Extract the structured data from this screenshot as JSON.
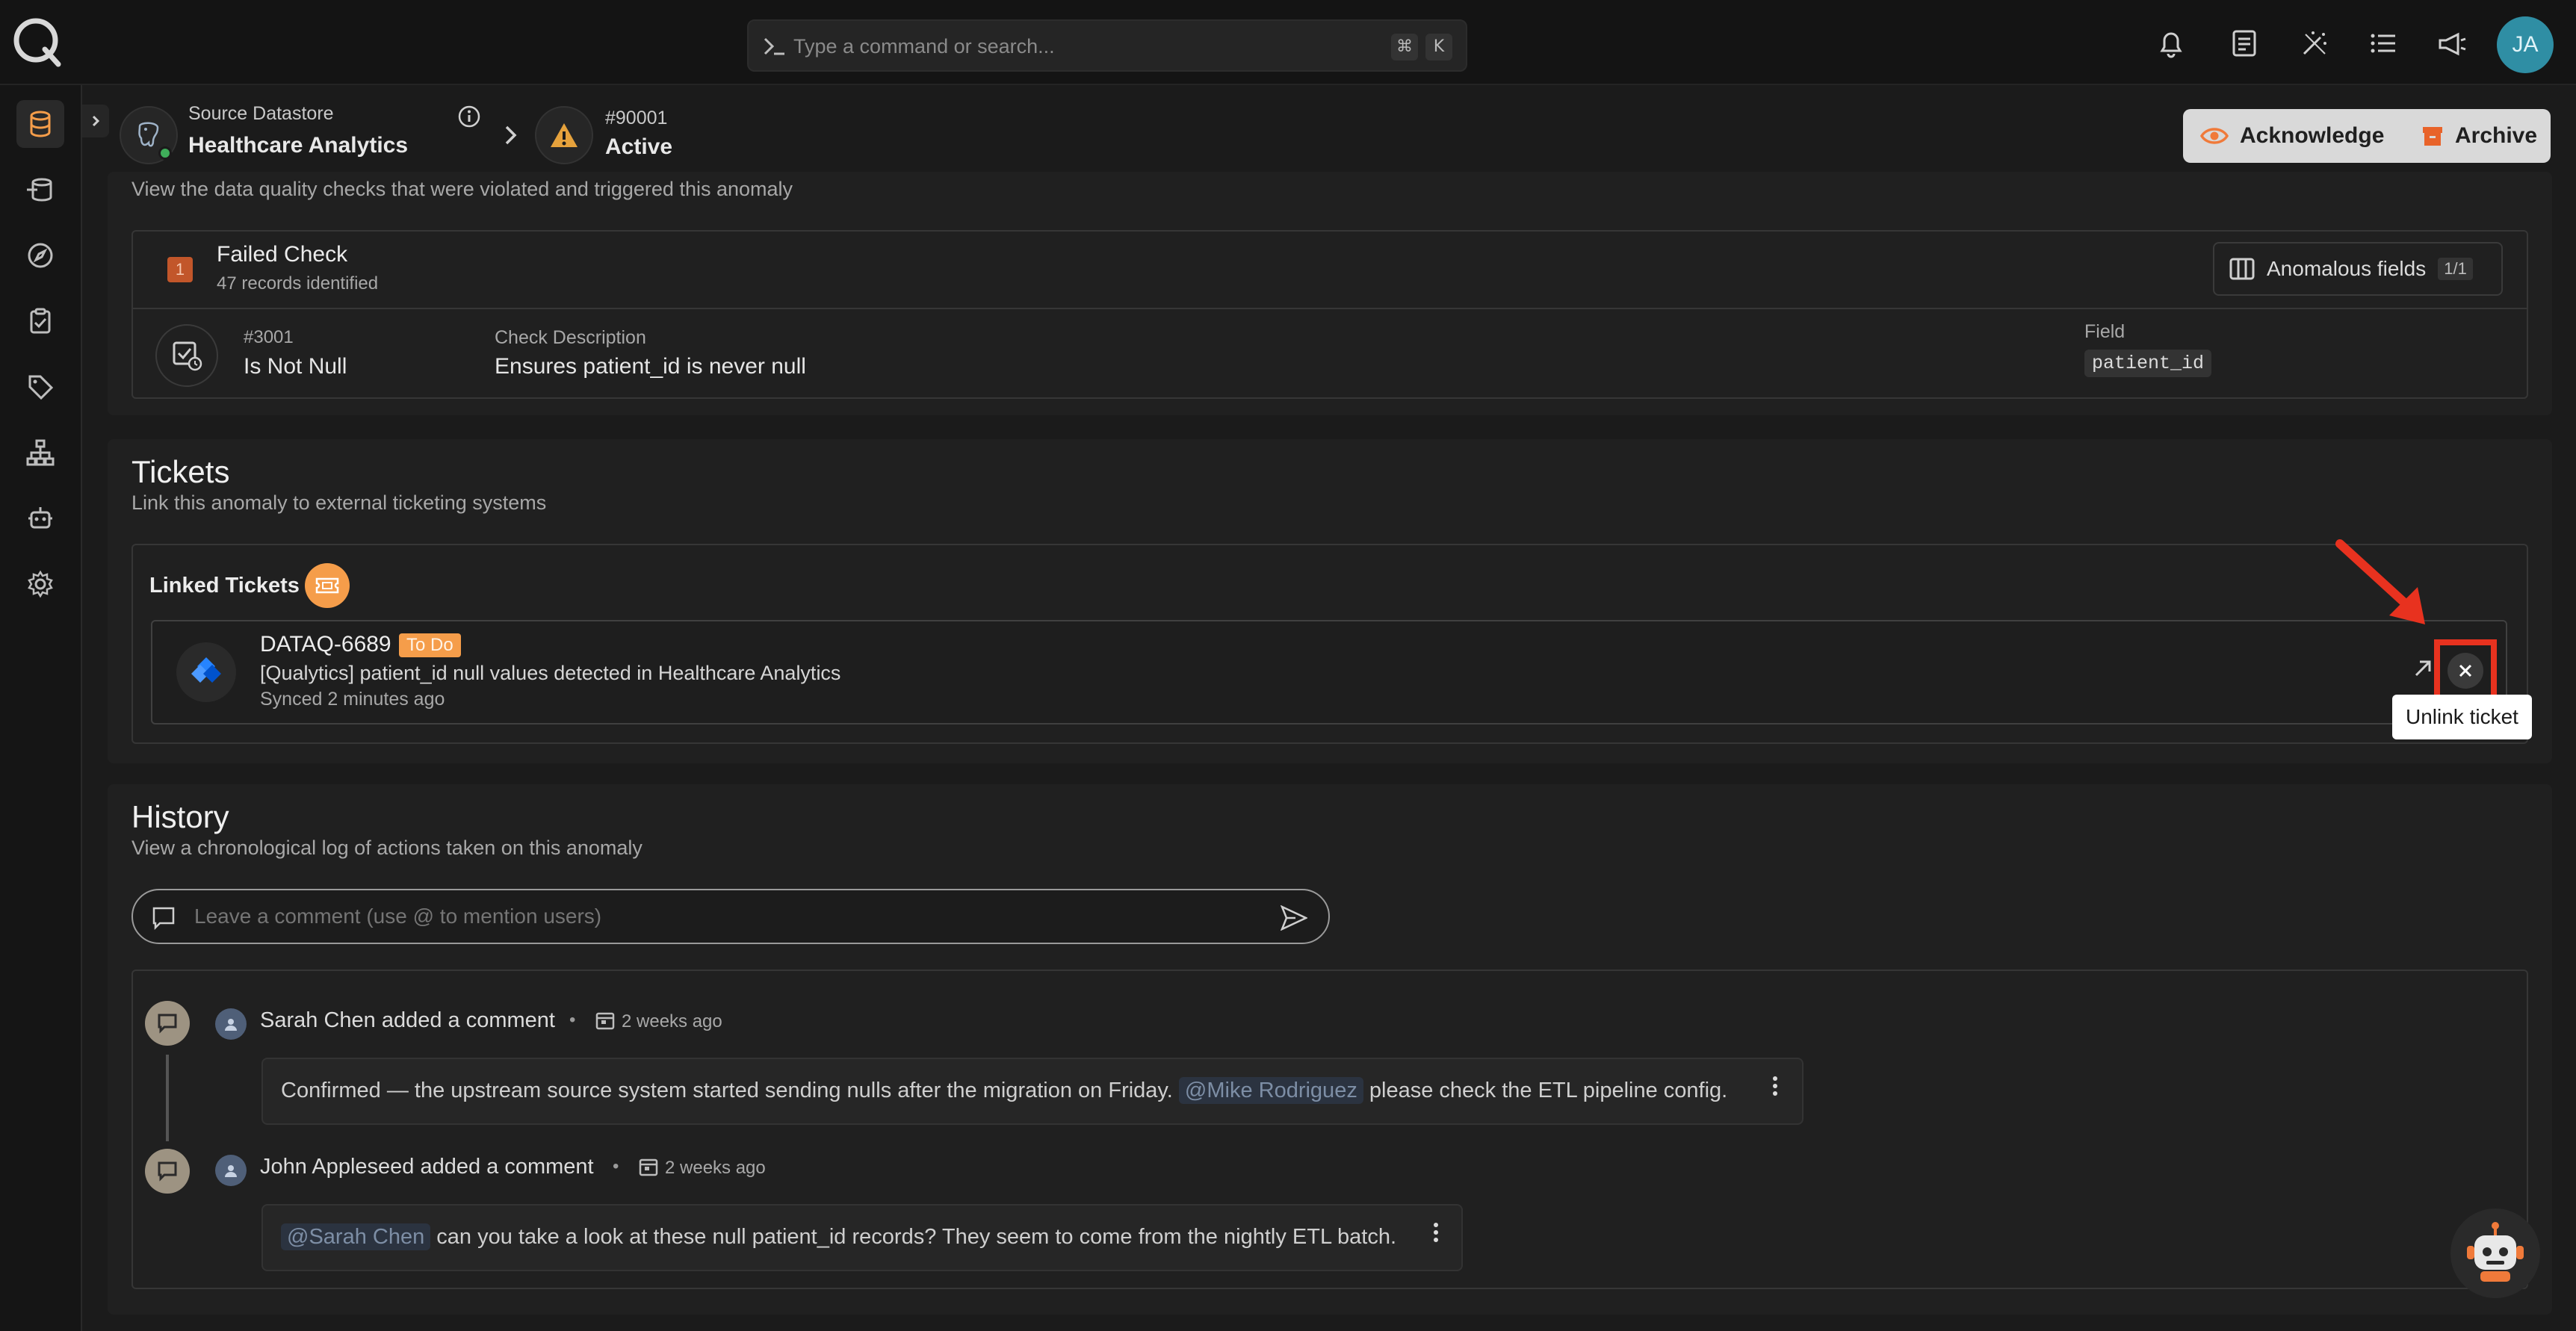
{
  "app": {
    "avatar_initials": "JA"
  },
  "search": {
    "placeholder": "Type a command or search...",
    "shortcut_mod": "⌘",
    "shortcut_key": "K"
  },
  "header": {
    "datastore_label": "Source Datastore",
    "datastore_name": "Healthcare Analytics",
    "anomaly_id": "#90001",
    "anomaly_status": "Active",
    "acknowledge_label": "Acknowledge",
    "archive_label": "Archive"
  },
  "checks": {
    "subtitle": "View the data quality checks that were violated and triggered this anomaly",
    "failed_count": "1",
    "failed_title": "Failed Check",
    "records": "47 records identified",
    "anomalous_label": "Anomalous fields",
    "anomalous_count": "1/1",
    "check_id": "#3001",
    "check_name": "Is Not Null",
    "desc_label": "Check Description",
    "desc_value": "Ensures patient_id is never null",
    "field_label": "Field",
    "field_value": "patient_id"
  },
  "tickets": {
    "title": "Tickets",
    "subtitle": "Link this anomaly to external ticketing systems",
    "linked_label": "Linked Tickets",
    "ticket": {
      "key": "DATAQ-6689",
      "status": "To Do",
      "summary": "[Qualytics] patient_id null values detected in Healthcare Analytics",
      "synced": "Synced 2 minutes ago"
    },
    "unlink_tooltip": "Unlink ticket"
  },
  "history": {
    "title": "History",
    "subtitle": "View a chronological log of actions taken on this anomaly",
    "comment_placeholder": "Leave a comment (use @ to mention users)",
    "entries": [
      {
        "author_action": "Sarah Chen added a comment",
        "time": "2 weeks ago",
        "text_before": "Confirmed — the upstream source system started sending nulls after the migration on Friday.",
        "mention": "@Mike Rodriguez",
        "text_after": "please check the ETL pipeline config."
      },
      {
        "author_action": "John Appleseed added a comment",
        "time": "2 weeks ago",
        "mention": "@Sarah Chen",
        "text_after": "can you take a look at these null patient_id records? They seem to come from the nightly ETL batch."
      }
    ]
  },
  "colors": {
    "accent_orange": "#f59d4a",
    "highlight_red": "#e8321f",
    "status_green": "#3fae5a",
    "warning_yellow": "#e6a23c"
  }
}
